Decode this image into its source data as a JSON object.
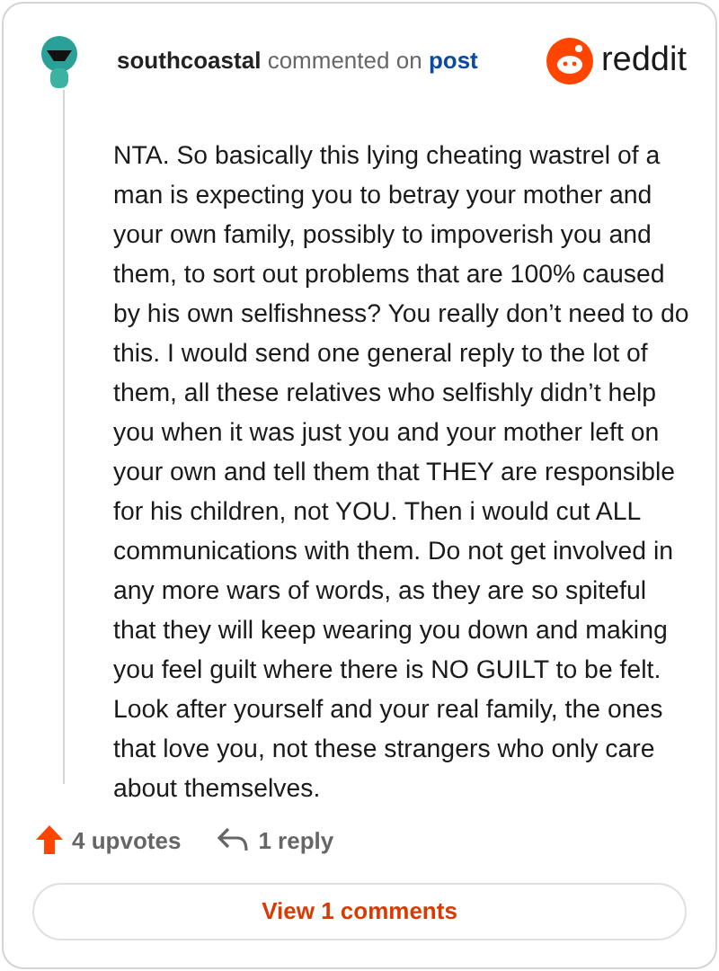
{
  "author": "southcoastal",
  "action": "commented on",
  "link": "post",
  "brand": "reddit",
  "body": "NTA. So basically this lying cheating wastrel of a man is expecting you to betray your mother and your own family, possibly to impoverish you and them, to sort out problems that are 100% caused by his own selfishness? You really don’t need to do this. I would send one general reply to the lot of them, all these relatives who selfishly didn’t help you when it was just you and your mother left on your own and tell them that THEY are responsible for his children, not YOU. Then i would cut ALL communications with them. Do not get involved in any more wars of words, as they are so spiteful that they will keep wearing you down and making you feel guilt where there is NO GUILT to be felt. Look after yourself and your real family, the ones that love you, not these strangers who only care about themselves.",
  "upvotes": "4 upvotes",
  "replies": "1 reply",
  "view_button": "View 1 comments"
}
